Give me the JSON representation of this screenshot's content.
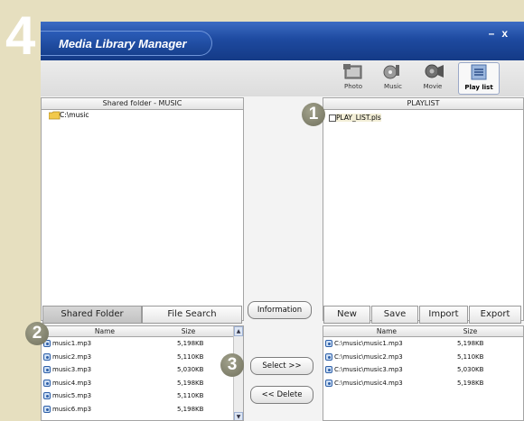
{
  "page": {
    "step_number": "4"
  },
  "window": {
    "title": "Media Library Manager",
    "minimize_glyph": "–",
    "close_glyph": "x"
  },
  "nav": [
    {
      "label": "Photo",
      "icon": "photo-icon"
    },
    {
      "label": "Music",
      "icon": "music-icon"
    },
    {
      "label": "Movie",
      "icon": "movie-icon"
    },
    {
      "label": "Play list",
      "icon": "playlist-icon",
      "active": true
    }
  ],
  "left_panel": {
    "header": "Shared folder - MUSIC",
    "tree": [
      {
        "label": "C:\\music",
        "icon": "folder-icon"
      }
    ],
    "tabs": [
      "Shared Folder",
      "File Search"
    ],
    "active_tab": "Shared Folder",
    "columns": [
      "Name",
      "Size"
    ],
    "files": [
      {
        "name": "music1.mp3",
        "size": "5,198KB"
      },
      {
        "name": "music2.mp3",
        "size": "5,110KB"
      },
      {
        "name": "music3.mp3",
        "size": "5,030KB"
      },
      {
        "name": "music4.mp3",
        "size": "5,198KB"
      },
      {
        "name": "music5.mp3",
        "size": "5,110KB"
      },
      {
        "name": "music6.mp3",
        "size": "5,198KB"
      }
    ]
  },
  "middle": {
    "information": "Information",
    "select": "Select >>",
    "delete": "<< Delete"
  },
  "right_panel": {
    "header": "PLAYLIST",
    "tree": [
      {
        "label": "PLAY_LIST.pls",
        "icon": "playlist-file-icon"
      }
    ],
    "actions": [
      "New",
      "Save",
      "Import",
      "Export"
    ],
    "columns": [
      "Name",
      "Size"
    ],
    "files": [
      {
        "name": "C:\\music\\music1.mp3",
        "size": "5,198KB"
      },
      {
        "name": "C:\\music\\music2.mp3",
        "size": "5,110KB"
      },
      {
        "name": "C:\\music\\music3.mp3",
        "size": "5,030KB"
      },
      {
        "name": "C:\\music\\music4.mp3",
        "size": "5,198KB"
      }
    ]
  },
  "callouts": [
    "1",
    "2",
    "3"
  ],
  "colors": {
    "titlebar": "#1e4aa0",
    "background": "#e6dfbf",
    "callout": "#7f7f6b"
  }
}
